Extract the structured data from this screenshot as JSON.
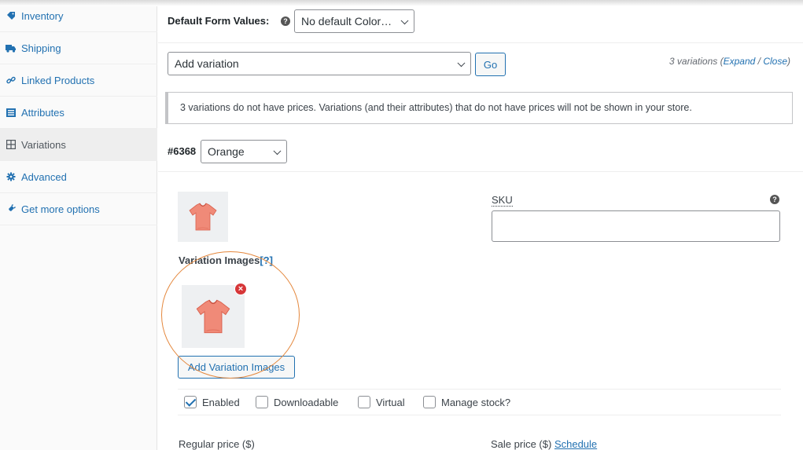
{
  "sidebar": {
    "items": [
      {
        "label": "Inventory",
        "icon": "tag-icon"
      },
      {
        "label": "Shipping",
        "icon": "truck-icon"
      },
      {
        "label": "Linked Products",
        "icon": "link-icon"
      },
      {
        "label": "Attributes",
        "icon": "list-icon"
      },
      {
        "label": "Variations",
        "icon": "grid-icon"
      },
      {
        "label": "Advanced",
        "icon": "gear-icon"
      },
      {
        "label": "Get more options",
        "icon": "plugin-icon"
      }
    ]
  },
  "defaults": {
    "label": "Default Form Values:",
    "help": "?",
    "selected": "No default Color…"
  },
  "actions": {
    "selected": "Add variation",
    "go_label": "Go",
    "count_text": "3 variations (",
    "expand": "Expand",
    "sep": " / ",
    "close": "Close",
    "end": ")"
  },
  "notice": "3 variations do not have prices. Variations (and their attributes) that do not have prices will not be shown in your store.",
  "variation": {
    "id": "#6368",
    "attribute_value": "Orange",
    "sku_label": "SKU",
    "sku_help": "?",
    "sku_value": "",
    "images_label": "Variation Images",
    "images_help": "[?]",
    "remove": "×",
    "add_images_label": "Add Variation Images",
    "options": {
      "enabled": "Enabled",
      "downloadable": "Downloadable",
      "virtual": "Virtual",
      "manage_stock": "Manage stock?"
    },
    "regular_price_label": "Regular price ($)",
    "sale_price_label": "Sale price ($)",
    "schedule": "Schedule"
  },
  "colors": {
    "link": "#2271b1",
    "highlight_circle": "#e4873c",
    "remove": "#d63638",
    "shirt": "#f08a78"
  }
}
